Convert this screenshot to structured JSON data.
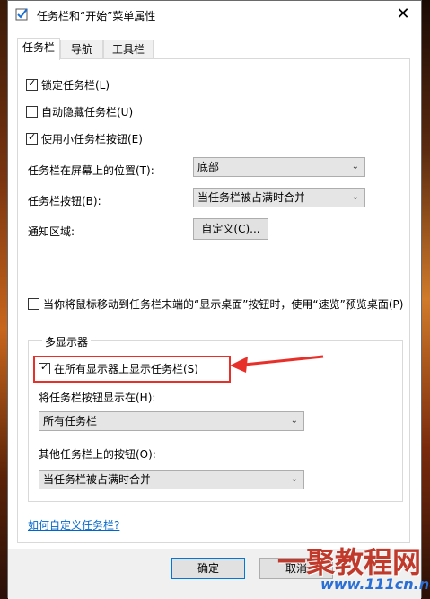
{
  "window": {
    "title": "任务栏和“开始”菜单属性"
  },
  "tabs": [
    {
      "label": "任务栏",
      "active": true
    },
    {
      "label": "导航",
      "active": false
    },
    {
      "label": "工具栏",
      "active": false
    }
  ],
  "options": {
    "lock_taskbar": {
      "label": "锁定任务栏(L)",
      "checked": true
    },
    "auto_hide": {
      "label": "自动隐藏任务栏(U)",
      "checked": false
    },
    "small_buttons": {
      "label": "使用小任务栏按钮(E)",
      "checked": true
    }
  },
  "position": {
    "label": "任务栏在屏幕上的位置(T):",
    "value": "底部"
  },
  "buttons_combine": {
    "label": "任务栏按钮(B):",
    "value": "当任务栏被占满时合并"
  },
  "notification": {
    "label": "通知区域:",
    "button": "自定义(C)..."
  },
  "peek": {
    "label": "当你将鼠标移动到任务栏末端的“显示桌面”按钮时，使用“速览”预览桌面(P)",
    "checked": false
  },
  "multi_display": {
    "group_title": "多显示器",
    "show_all": {
      "label": "在所有显示器上显示任务栏(S)",
      "checked": true
    },
    "show_buttons_on": {
      "label": "将任务栏按钮显示在(H):",
      "value": "所有任务栏"
    },
    "other_buttons": {
      "label": "其他任务栏上的按钮(O):",
      "value": "当任务栏被占满时合并"
    }
  },
  "help_link": "如何自定义任务栏?",
  "footer": {
    "ok": "确定",
    "cancel": "取消"
  },
  "watermark": {
    "brand": "一聚教程网",
    "url": "www.111cn.net"
  },
  "icons": {
    "check": "✓",
    "chevron": "⌄",
    "close": "✕"
  },
  "colors": {
    "highlight_box": "#e8302a",
    "link": "#0066cc"
  }
}
